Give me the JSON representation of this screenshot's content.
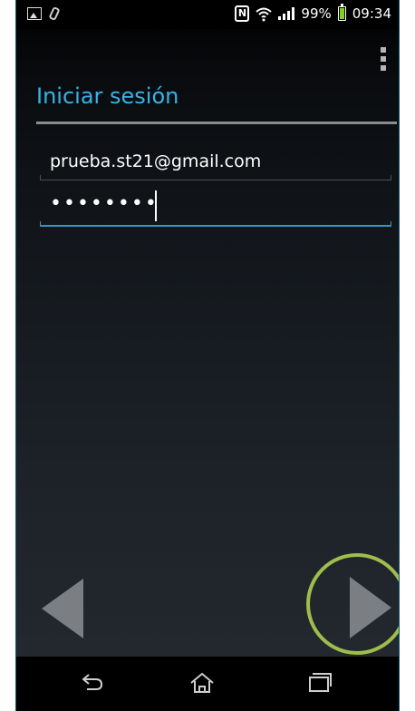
{
  "status_bar": {
    "left_icons": [
      "image-notification-icon",
      "clip-notification-icon"
    ],
    "nfc_label": "N",
    "battery": "99%",
    "time": "09:34"
  },
  "header": {
    "title": "Iniciar sesión"
  },
  "form": {
    "email_value": "prueba.st21@gmail.com",
    "password_value": "••••••••"
  },
  "navigation": {
    "prev_icon": "left-arrow-icon",
    "next_icon": "right-arrow-icon"
  },
  "system_nav": {
    "back_icon": "back-icon",
    "home_icon": "home-icon",
    "recents_icon": "recents-icon"
  },
  "colors": {
    "accent": "#35b5e5",
    "highlight_circle": "#9fbd4c",
    "battery": "#7fce2a"
  }
}
